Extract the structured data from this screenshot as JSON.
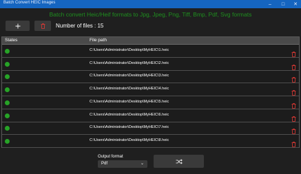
{
  "window": {
    "title": "Batch Convert HEIC Images"
  },
  "heading": "Batch convert Heic/Heif formats to Jpg, Jpeg, Png, Tiff, Bmp, Pdf, Svg formats",
  "toolbar": {
    "add_icon": "plus-icon",
    "clear_icon": "trash-icon",
    "count_text": "Number of files : 15"
  },
  "table": {
    "headers": {
      "status": "States",
      "path": "File path"
    },
    "rows": [
      {
        "status": "ok",
        "path": "C:\\Users\\Administrator\\Desktop\\MyHEIC\\1.heic"
      },
      {
        "status": "ok",
        "path": "C:\\Users\\Administrator\\Desktop\\MyHEIC\\2.heic"
      },
      {
        "status": "ok",
        "path": "C:\\Users\\Administrator\\Desktop\\MyHEIC\\3.heic"
      },
      {
        "status": "ok",
        "path": "C:\\Users\\Administrator\\Desktop\\MyHEIC\\4.heic"
      },
      {
        "status": "ok",
        "path": "C:\\Users\\Administrator\\Desktop\\MyHEIC\\5.heic"
      },
      {
        "status": "ok",
        "path": "C:\\Users\\Administrator\\Desktop\\MyHEIC\\6.heic"
      },
      {
        "status": "ok",
        "path": "C:\\Users\\Administrator\\Desktop\\MyHEIC\\7.heic"
      },
      {
        "status": "ok",
        "path": "C:\\Users\\Administrator\\Desktop\\MyHEIC\\8.heic"
      }
    ]
  },
  "output": {
    "label": "Output format",
    "selected": "Pdf",
    "convert_icon": "shuffle-icon"
  },
  "colors": {
    "accent": "#1565c0",
    "heading": "#1f8f1f",
    "status_ok": "#27a327",
    "delete": "#e53935"
  }
}
